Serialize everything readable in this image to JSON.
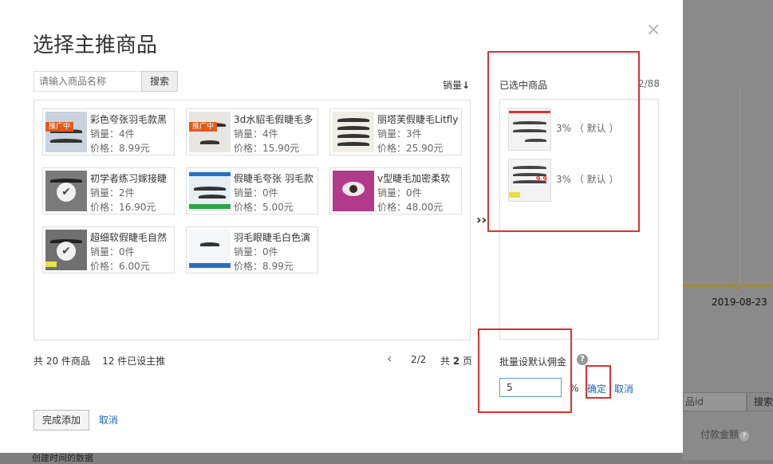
{
  "background": {
    "date": "2019-08-23",
    "id_input_text": "品id",
    "search_label": "搜索",
    "column_header": "付款金额",
    "help_icon": "question-icon",
    "bottom_text": "创建时间的数据"
  },
  "dialog": {
    "title": "选择主推商品",
    "close_icon": "close-icon",
    "search": {
      "placeholder": "请输入商品名称",
      "button_label": "搜索"
    },
    "sort_label": "销量",
    "sort_icon": "arrow-down-icon",
    "products": [
      {
        "name": "彩色夸张羽毛款黑",
        "sales": "销量：4件",
        "price": "价格：8.99元",
        "tag": "推广中",
        "selected": false
      },
      {
        "name": "3d水貂毛假睫毛多",
        "sales": "销量：4件",
        "price": "价格：15.90元",
        "tag": "推广中",
        "selected": false
      },
      {
        "name": "丽塔芙假睫毛Litfly",
        "sales": "销量：3件",
        "price": "价格：25.90元",
        "tag": "",
        "selected": false
      },
      {
        "name": "初学者练习嫁接睫",
        "sales": "销量：2件",
        "price": "价格：16.90元",
        "tag": "",
        "selected": true
      },
      {
        "name": "假睫毛夸张 羽毛款",
        "sales": "销量：0件",
        "price": "价格：5.00元",
        "tag": "",
        "selected": false
      },
      {
        "name": "v型睫毛加密柔软",
        "sales": "销量：0件",
        "price": "价格：48.00元",
        "tag": "",
        "selected": false
      },
      {
        "name": "超细软假睫毛自然",
        "sales": "销量：0件",
        "price": "价格：6.00元",
        "tag": "",
        "selected": true
      },
      {
        "name": "羽毛眼睫毛白色演",
        "sales": "销量：0件",
        "price": "价格：8.99元",
        "tag": "",
        "selected": false
      }
    ],
    "summary": "共 20 件商品    12 件已设主推",
    "pager": {
      "prev_icon": "chevron-left-icon",
      "page": "2/2",
      "total_prefix": "共 ",
      "total": "2",
      "total_suffix": " 页"
    },
    "move_icon": "double-chevron-right-icon",
    "selected_panel": {
      "title": "已选中商品",
      "count": "2/88",
      "items": [
        {
          "rate": "3% （ 默认 ）"
        },
        {
          "rate": "3% （ 默认 ）"
        }
      ]
    },
    "batch": {
      "label": "批量设默认佣金",
      "help_icon": "question-icon",
      "value": "5",
      "unit": "%",
      "confirm_label": "确定",
      "cancel_label": "取消"
    },
    "footer": {
      "done_label": "完成添加",
      "cancel_label": "取消"
    }
  },
  "colors": {
    "annotation": "#e03030",
    "link": "#1a66b8",
    "tag": "#e05a1e",
    "timeline": "#e8c02a"
  }
}
